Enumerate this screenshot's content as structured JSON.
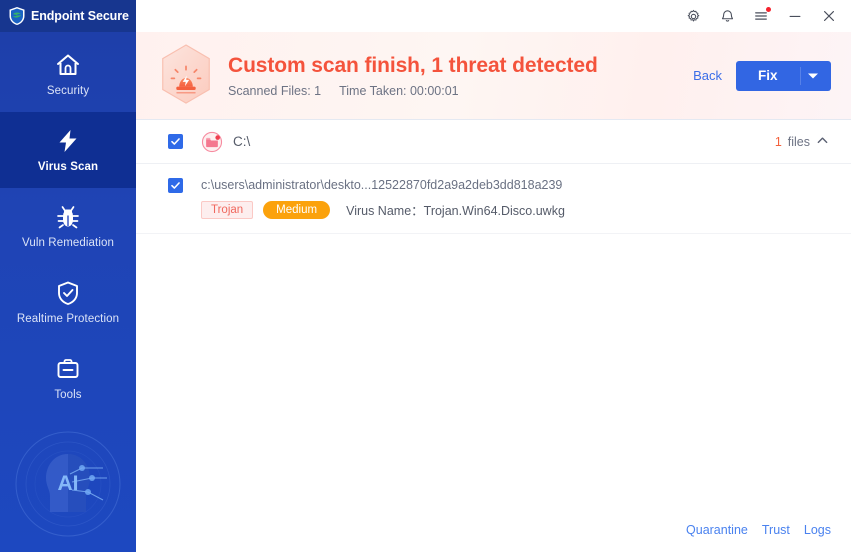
{
  "window": {
    "brand": "Endpoint Secure",
    "titlebar_buttons": [
      {
        "name": "settings-button",
        "icon": "gear-icon"
      },
      {
        "name": "notifications-button",
        "icon": "bell-icon",
        "badge": true
      },
      {
        "name": "menu-button",
        "icon": "hamburger-icon",
        "badge": true
      },
      {
        "name": "minimize-button",
        "icon": "minimize-icon"
      },
      {
        "name": "close-button",
        "icon": "close-icon"
      }
    ]
  },
  "sidebar": {
    "items": [
      {
        "label": "Security",
        "icon": "home-icon",
        "active": false
      },
      {
        "label": "Virus Scan",
        "icon": "lightning-icon",
        "active": true
      },
      {
        "label": "Vuln Remediation",
        "icon": "bug-icon",
        "active": false
      },
      {
        "label": "Realtime Protection",
        "icon": "shield-check-icon",
        "active": false
      },
      {
        "label": "Tools",
        "icon": "toolbox-icon",
        "active": false
      }
    ],
    "watermark_text": "AI"
  },
  "header": {
    "icon": "alarm-hexagon-icon",
    "title": "Custom scan finish, 1 threat detected",
    "scanned_files": "Scanned Files: 1",
    "time_taken": "Time Taken: 00:00:01",
    "back_label": "Back",
    "fix_label": "Fix",
    "title_color": "#f4533c",
    "fix_button_color": "#3266e3"
  },
  "results": {
    "group": {
      "checked": true,
      "icon": "folder-alert-icon",
      "drive": "C:\\",
      "count": "1",
      "count_unit": "files",
      "expanded": true
    },
    "threats": [
      {
        "checked": true,
        "path": "c:\\users\\administrator\\deskto...12522870fd2a9a2deb3dd818a239",
        "type_tag": "Trojan",
        "severity_tag": "Medium",
        "virus_name": "Virus Name：Trojan.Win64.Disco.uwkg",
        "type_tag_color": "#f0685e",
        "severity_tag_color": "#fba20c"
      }
    ]
  },
  "footer": {
    "links": [
      {
        "label": "Quarantine"
      },
      {
        "label": "Trust"
      },
      {
        "label": "Logs"
      }
    ]
  }
}
